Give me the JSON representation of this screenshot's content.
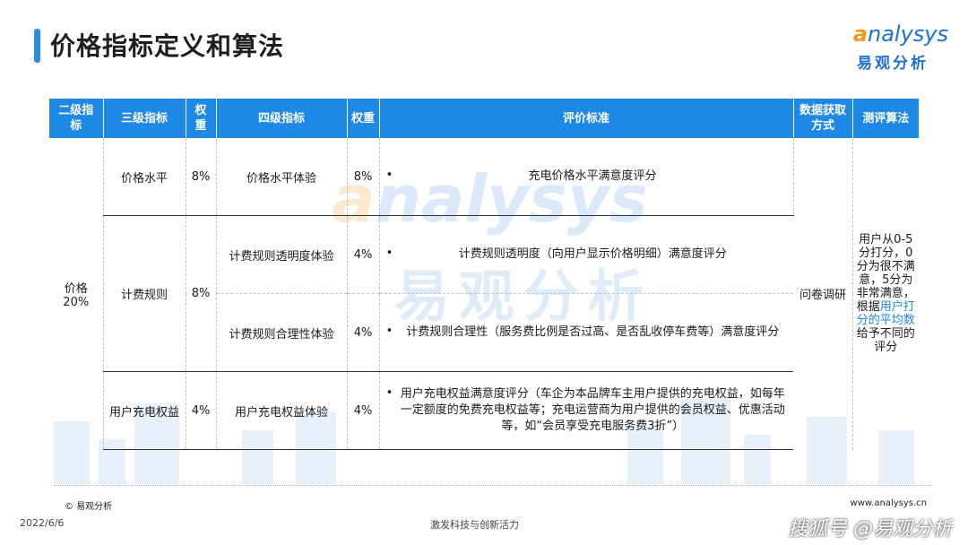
{
  "header": {
    "title": "价格指标定义和算法",
    "logo_word_lead": "a",
    "logo_word_rest": "nalysys",
    "logo_cn": "易观分析"
  },
  "watermark": {
    "word_lead": "a",
    "word_rest": "nalysys",
    "cn": "易观分析"
  },
  "table": {
    "headers": [
      "二级指标",
      "三级指标",
      "权重",
      "四级指标",
      "权重",
      "评价标准",
      "数据获取方式",
      "测评算法"
    ],
    "level2": {
      "name": "价格",
      "weight": "20%"
    },
    "level3": [
      {
        "name": "价格水平",
        "weight": "8%"
      },
      {
        "name": "计费规则",
        "weight": "8%"
      },
      {
        "name": "用户充电权益",
        "weight": "4%"
      }
    ],
    "level4": [
      {
        "name": "价格水平体验",
        "weight": "8%",
        "criterion": "充电价格水平满意度评分"
      },
      {
        "name": "计费规则透明度体验",
        "weight": "4%",
        "criterion": "计费规则透明度（向用户显示价格明细）满意度评分"
      },
      {
        "name": "计费规则合理性体验",
        "weight": "4%",
        "criterion": "计费规则合理性（服务费比例是否过高、是否乱收停车费等）满意度评分"
      },
      {
        "name": "用户充电权益体验",
        "weight": "4%",
        "criterion": "用户充电权益满意度评分（车企为本品牌车主用户提供的充电权益，如每年一定额度的免费充电权益等；充电运营商为用户提供的会员权益、优惠活动等，如“会员享受充电服务费3折”）"
      }
    ],
    "bullet": "•",
    "data_method": "问卷调研",
    "algorithm": {
      "part1": "用户从0-5分打分，0分为很不满意，5分为非常满意，根据",
      "highlight": "用户打分的平均数",
      "part2": "给予不同的评分"
    }
  },
  "footer": {
    "copyright": "© 易观分析",
    "website": "www.analysys.cn",
    "date": "2022/6/6",
    "slogan": "激发科技与创新活力",
    "brand": "搜狐号 @易观分析"
  },
  "colors": {
    "accent": "#1e88e5",
    "logo_orange": "#f39a1e"
  }
}
